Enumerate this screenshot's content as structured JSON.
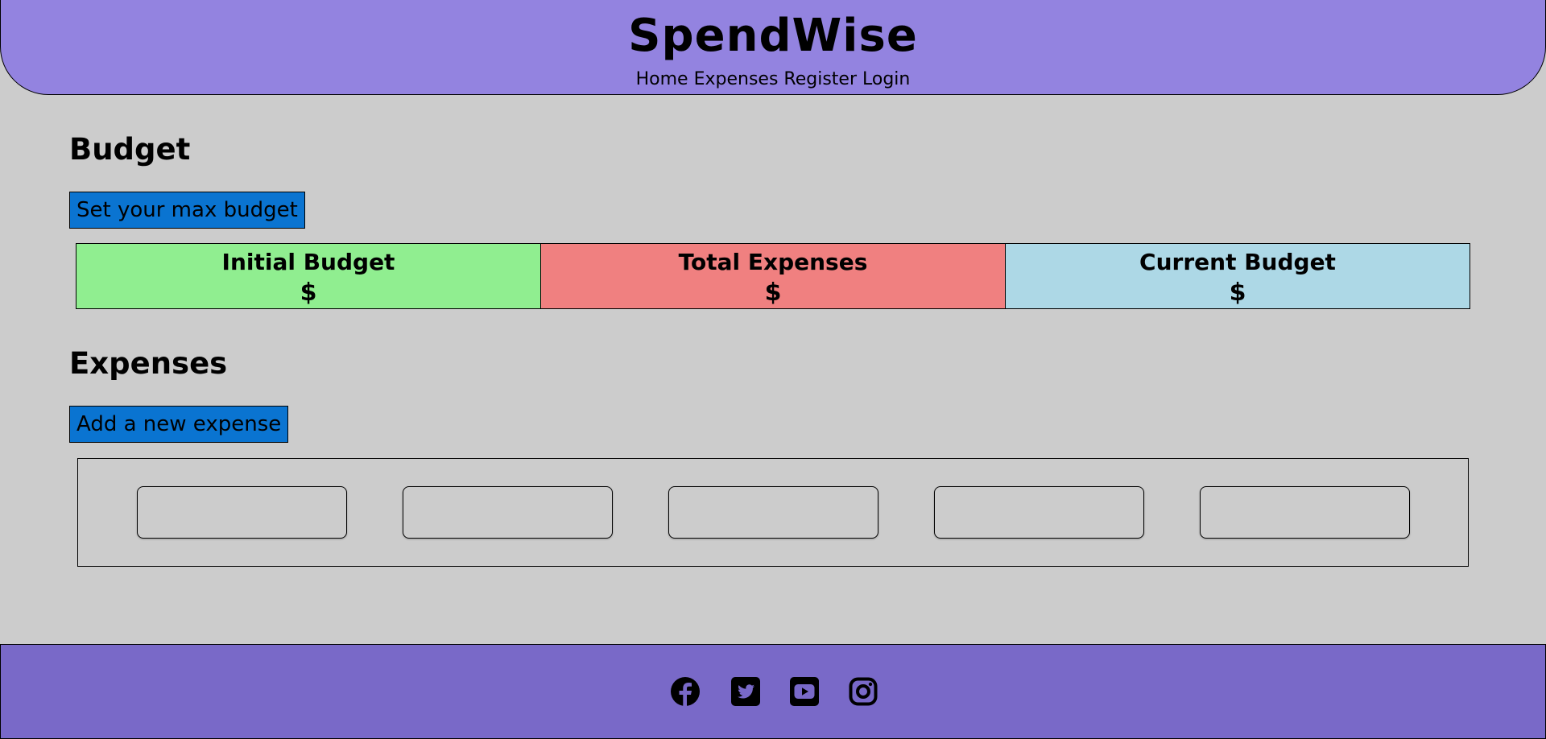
{
  "header": {
    "brand": "SpendWise",
    "nav": [
      "Home",
      "Expenses",
      "Register",
      "Login"
    ]
  },
  "budget": {
    "title": "Budget",
    "set_button": "Set your max budget",
    "cells": [
      {
        "label": "Initial Budget",
        "amount": "$",
        "color": "#90ee90"
      },
      {
        "label": "Total Expenses",
        "amount": "$",
        "color": "#f08080"
      },
      {
        "label": "Current Budget",
        "amount": "$",
        "color": "#add8e6"
      }
    ]
  },
  "expenses": {
    "title": "Expenses",
    "add_button": "Add a new expense",
    "fields": [
      "",
      "",
      "",
      "",
      ""
    ]
  },
  "footer": {
    "icons": [
      "facebook-icon",
      "twitter-icon",
      "youtube-icon",
      "instagram-icon"
    ]
  },
  "colors": {
    "header": "#9383e0",
    "footer": "#7969c8",
    "background": "#cccccc",
    "button": "#0a74d1"
  }
}
